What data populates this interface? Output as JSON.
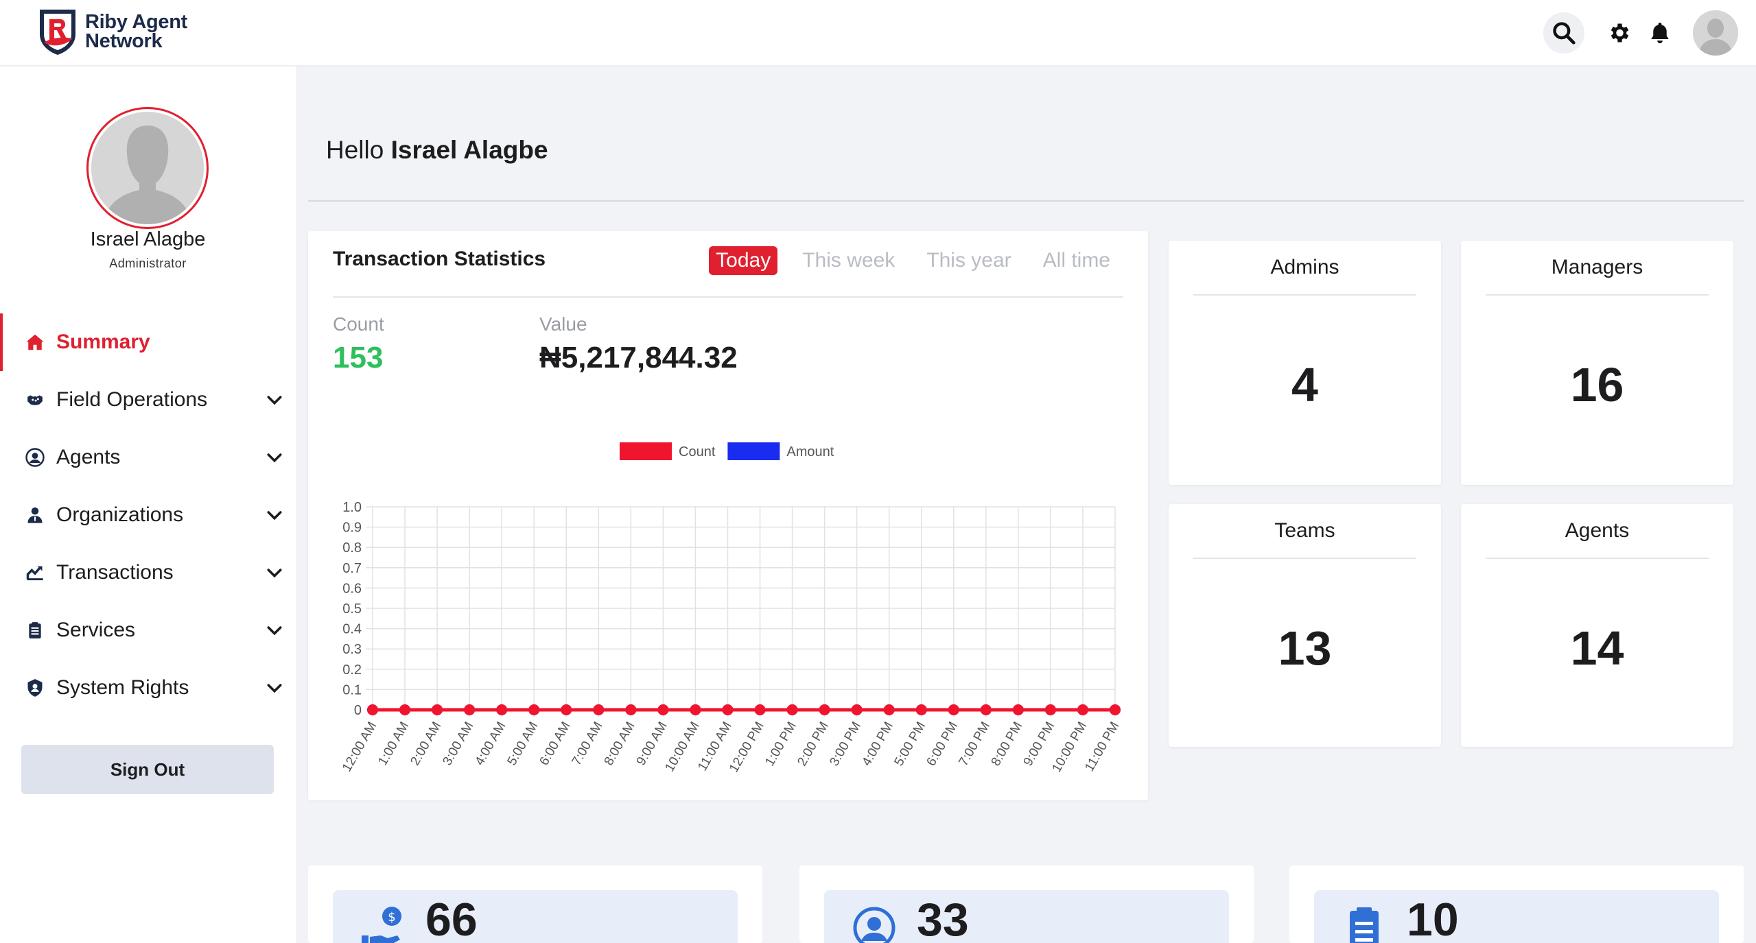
{
  "brand": {
    "name_line1": "Riby Agent",
    "name_line2": "Network"
  },
  "header": {
    "search_icon": "search-icon",
    "settings_icon": "gear-icon",
    "notifications_icon": "bell-icon"
  },
  "user": {
    "name": "Israel Alagbe",
    "role": "Administrator"
  },
  "nav": [
    {
      "label": "Summary",
      "icon": "home-icon",
      "active": true,
      "expandable": false
    },
    {
      "label": "Field Operations",
      "icon": "handshake-icon",
      "expandable": true
    },
    {
      "label": "Agents",
      "icon": "user-circle-icon",
      "expandable": true
    },
    {
      "label": "Organizations",
      "icon": "user-tie-icon",
      "expandable": true
    },
    {
      "label": "Transactions",
      "icon": "chart-line-icon",
      "expandable": true
    },
    {
      "label": "Services",
      "icon": "clipboard-icon",
      "expandable": true
    },
    {
      "label": "System Rights",
      "icon": "shield-user-icon",
      "expandable": true
    }
  ],
  "signout_label": "Sign Out",
  "greeting": {
    "prefix": "Hello",
    "name": "Israel Alagbe"
  },
  "stats": {
    "title": "Transaction Statistics",
    "tabs": [
      "Today",
      "This week",
      "This year",
      "All time"
    ],
    "active_tab": "Today",
    "count_label": "Count",
    "count_value": "153",
    "value_label": "Value",
    "value_amount": "₦5,217,844.32"
  },
  "colors": {
    "accent": "#e0202f",
    "count_green": "#2fbf5e",
    "amount_blue": "#1a2cf0"
  },
  "chart_data": {
    "type": "line",
    "x": [
      "12:00 AM",
      "1:00 AM",
      "2:00 AM",
      "3:00 AM",
      "4:00 AM",
      "5:00 AM",
      "6:00 AM",
      "7:00 AM",
      "8:00 AM",
      "9:00 AM",
      "10:00 AM",
      "11:00 AM",
      "12:00 PM",
      "1:00 PM",
      "2:00 PM",
      "3:00 PM",
      "4:00 PM",
      "5:00 PM",
      "6:00 PM",
      "7:00 PM",
      "8:00 PM",
      "9:00 PM",
      "10:00 PM",
      "11:00 PM"
    ],
    "series": [
      {
        "name": "Count",
        "color": "#f0142f",
        "values": [
          0,
          0,
          0,
          0,
          0,
          0,
          0,
          0,
          0,
          0,
          0,
          0,
          0,
          0,
          0,
          0,
          0,
          0,
          0,
          0,
          0,
          0,
          0,
          0
        ]
      },
      {
        "name": "Amount",
        "color": "#1a2cf0",
        "values": [
          0,
          0,
          0,
          0,
          0,
          0,
          0,
          0,
          0,
          0,
          0,
          0,
          0,
          0,
          0,
          0,
          0,
          0,
          0,
          0,
          0,
          0,
          0,
          0
        ]
      }
    ],
    "yticks": [
      "0",
      "0.1",
      "0.2",
      "0.3",
      "0.4",
      "0.5",
      "0.6",
      "0.7",
      "0.8",
      "0.9",
      "1.0"
    ],
    "ylim": [
      0,
      1
    ],
    "grid": true,
    "legend": "top"
  },
  "summary_boxes": [
    {
      "label": "Admins",
      "value": "4"
    },
    {
      "label": "Managers",
      "value": "16"
    },
    {
      "label": "Teams",
      "value": "13"
    },
    {
      "label": "Agents",
      "value": "14"
    }
  ],
  "bottom_cards": [
    {
      "value": "66",
      "icon": "hand-money-icon"
    },
    {
      "value": "33",
      "icon": "user-circle-icon"
    },
    {
      "value": "10",
      "icon": "clipboard-icon"
    }
  ]
}
